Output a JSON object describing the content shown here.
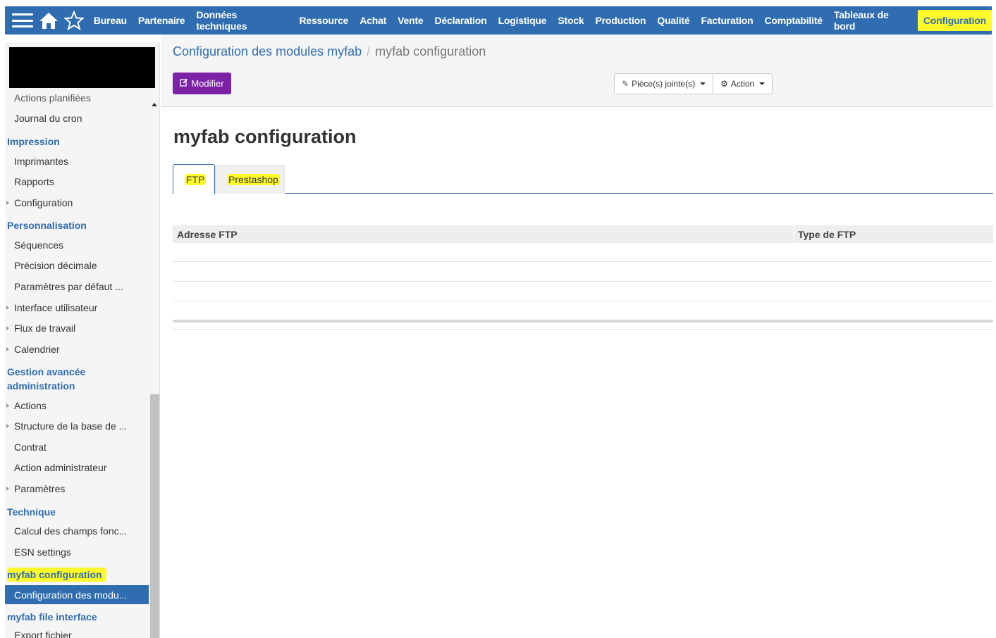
{
  "topnav": {
    "items": [
      "Bureau",
      "Partenaire",
      "Données techniques",
      "Ressource",
      "Achat",
      "Vente",
      "Déclaration",
      "Logistique",
      "Stock",
      "Production",
      "Qualité",
      "Facturation",
      "Comptabilité",
      "Tableaux de bord"
    ],
    "active_item": "Configuration",
    "bar_color": "#2f6cb0",
    "highlight_color": "#fffb2a"
  },
  "sidebar": {
    "partial_top": "Actions planifiées",
    "items": {
      "journal_cron": "Journal du cron",
      "impression": "Impression",
      "imprimantes": "Imprimantes",
      "rapports": "Rapports",
      "configuration": "Configuration",
      "personnalisation": "Personnalisation",
      "sequences": "Séquences",
      "precision": "Précision décimale",
      "parametres_defaut": "Paramètres par défaut ...",
      "interface": "Interface utilisateur",
      "flux": "Flux de travail",
      "calendrier": "Calendrier",
      "gestion_avancee_1": "Gestion avancée",
      "gestion_avancee_2": "administration",
      "actions": "Actions",
      "structure": "Structure de la base de ...",
      "contrat": "Contrat",
      "action_admin": "Action administrateur",
      "parametres": "Paramètres",
      "technique": "Technique",
      "calcul": "Calcul des champs fonc...",
      "esn": "ESN settings",
      "myfab_config": "myfab configuration",
      "config_modules": "Configuration des modu...",
      "myfab_file": "myfab file interface",
      "export": "Export fichier"
    }
  },
  "main": {
    "breadcrumb": {
      "link": "Configuration des modules myfab",
      "separator": "/",
      "current": "myfab configuration"
    },
    "modify_button": "Modifier",
    "attachments_button": "Pièce(s) jointe(s)",
    "action_button": "Action",
    "title": "myfab configuration",
    "tabs": [
      "FTP",
      "Prestashop"
    ],
    "table": {
      "columns": [
        "Adresse FTP",
        "Type de FTP"
      ]
    },
    "accent_color": "#7b22a6"
  }
}
